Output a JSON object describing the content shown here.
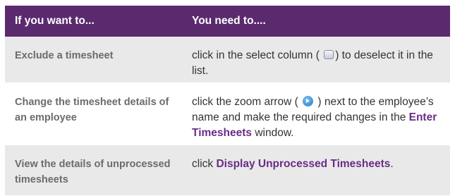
{
  "header": {
    "col1": "If you want to...",
    "col2": "You need to...."
  },
  "rows": [
    {
      "action": "Exclude a timesheet",
      "instr_before": "click in the select column (",
      "instr_icon": "checkbox-icon",
      "instr_after": ") to deselect it in the list."
    },
    {
      "action": "Change the timesheet details of an employee",
      "instr_before": "click the zoom arrow (",
      "instr_icon": "zoom-arrow-icon",
      "instr_mid": ") next to the employee’s name and make the required changes in the",
      "instr_link": "Enter Timesheets",
      "instr_after": "window."
    },
    {
      "action": "View the details of unprocessed timesheets",
      "instr_before": "click",
      "instr_link": "Display Unprocessed Timesheets",
      "instr_after": "."
    }
  ],
  "colors": {
    "header_bg": "#5b2a6e",
    "row_shade": "#e9e9ea",
    "link": "#6a2c86"
  }
}
